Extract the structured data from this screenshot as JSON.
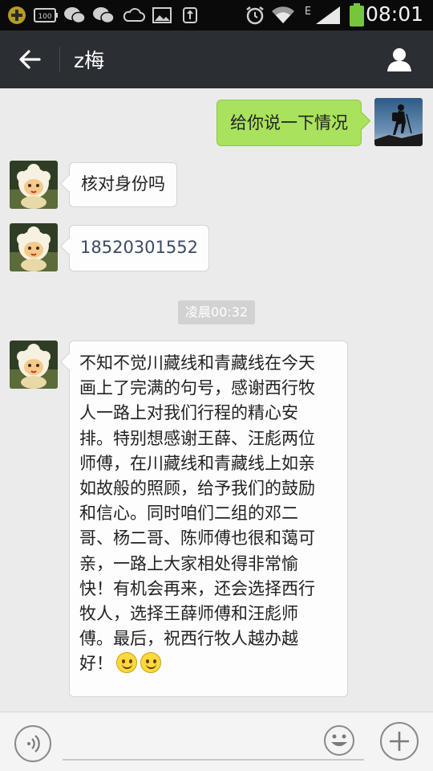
{
  "status_bar": {
    "time": "08:01",
    "network_type": "E",
    "icons": [
      "plus-notification-icon",
      "battery-100-icon",
      "wechat-icon",
      "wechat-icon",
      "cloud-icon",
      "image-icon",
      "usb-icon",
      "alarm-icon",
      "wifi-icon",
      "signal-icon",
      "battery-icon"
    ]
  },
  "header": {
    "title": "z梅"
  },
  "messages": [
    {
      "from": "me",
      "text": "给你说一下情况"
    },
    {
      "from": "contact",
      "text": "核对身份吗"
    },
    {
      "from": "contact",
      "text": "18520301552"
    },
    {
      "timestamp": "凌晨00:32"
    },
    {
      "from": "contact",
      "lines": [
        "不知不觉川藏线和青藏线在今天",
        "画上了完满的句号，感谢西行牧",
        "人一路上对我们行程的精心安",
        "排。特别想感谢王薛、汪彪两位",
        "师傅，在川藏线和青藏线上如亲",
        "如故般的照顾，给予我们的鼓励",
        "和信心。同时咱们二组的邓二",
        "哥、杨二哥、陈师傅也很和蔼可",
        "亲，一路上大家相处得非常愉",
        "快！有机会再来，还会选择西行",
        "牧人，选择王薛师傅和汪彪师",
        "傅。最后，祝西行牧人越办越",
        "好！"
      ],
      "emojis": [
        "smile-emoji",
        "smile-emoji"
      ]
    }
  ],
  "colors": {
    "status_bar_bg": "#0a0a0a",
    "title_bar_bg": "#2b2e33",
    "chat_bg": "#ebebeb",
    "my_bubble": "#a9e25c",
    "contact_bubble": "#fdfdfd",
    "timestamp_bg": "#d2d2d2"
  }
}
